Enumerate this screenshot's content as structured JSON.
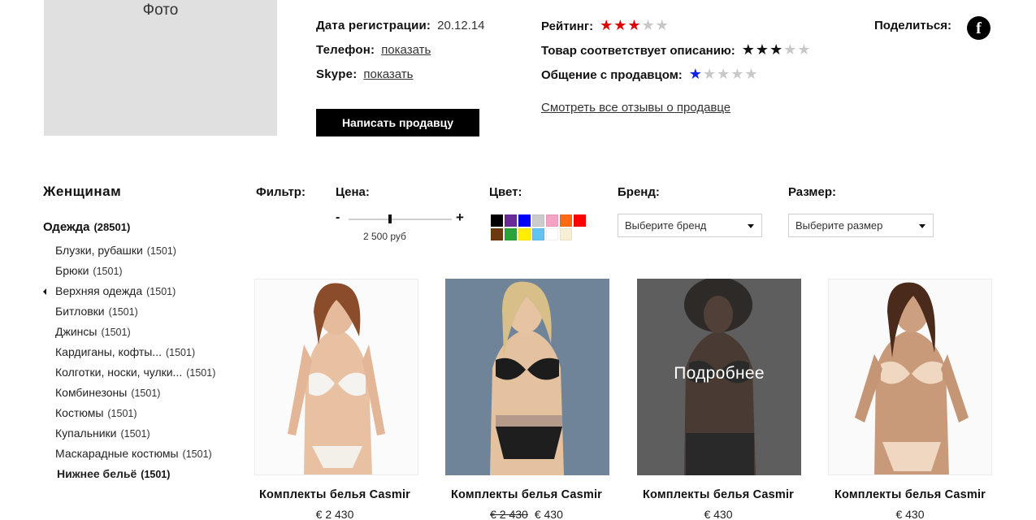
{
  "seller": {
    "photo_label": "Фото",
    "reg_label": "Дата регистрации:",
    "reg_date": "20.12.14",
    "phone_label": "Телефон:",
    "phone_link": "показать",
    "skype_label": "Skype:",
    "skype_link": "показать",
    "write_button": "Написать продавцу"
  },
  "ratings": {
    "rating_label": "Рейтинг:",
    "rating_value": 3,
    "description_label": "Товар соответствует описанию:",
    "description_value": 3,
    "communication_label": "Общение с продавцом:",
    "communication_value": 1,
    "max": 5,
    "colors": {
      "rating": "#e00000",
      "description": "#111111",
      "communication": "#1622e6",
      "off": "#c8c8c8"
    },
    "all_reviews_link": "Смотреть все отзывы о продавце"
  },
  "share": {
    "label": "Поделиться:",
    "icon": "facebook-icon",
    "icon_glyph": "f"
  },
  "sidebar": {
    "title": "Женщинам",
    "main_category": {
      "label": "Одежда",
      "count": "(28501)"
    },
    "items": [
      {
        "label": "Блузки, рубашки",
        "count": "(1501)"
      },
      {
        "label": "Брюки",
        "count": "(1501)"
      },
      {
        "label": "Верхняя одежда",
        "count": "(1501)"
      },
      {
        "label": "Битловки",
        "count": "(1501)"
      },
      {
        "label": "Джинсы",
        "count": "(1501)"
      },
      {
        "label": "Кардиганы, кофты...",
        "count": "(1501)"
      },
      {
        "label": "Колготки, носки, чулки...",
        "count": "(1501)"
      },
      {
        "label": "Комбинезоны",
        "count": "(1501)"
      },
      {
        "label": "Костюмы",
        "count": "(1501)"
      },
      {
        "label": "Купальники",
        "count": "(1501)"
      },
      {
        "label": "Маскарадные костюмы",
        "count": "(1501)"
      },
      {
        "label": "Нижнее бельё",
        "count": "(1501)"
      }
    ]
  },
  "filter": {
    "label": "Фильтр:",
    "price": {
      "label": "Цена:",
      "minus": "-",
      "plus": "+",
      "value": "2 500 руб",
      "level": 0.4
    },
    "color": {
      "label": "Цвет:",
      "swatches": [
        "#000000",
        "#6a2a9a",
        "#0000ff",
        "#cccccc",
        "#f4a3c4",
        "#ff6a13",
        "#ff0000",
        "#6b3a10",
        "#2aa33a",
        "#ffee00",
        "#62c4f0",
        "#ffffff",
        "#f7efd4"
      ]
    },
    "brand": {
      "label": "Бренд:",
      "placeholder": "Выберите бренд"
    },
    "size": {
      "label": "Размер:",
      "placeholder": "Выберите размер"
    }
  },
  "products": [
    {
      "title": "Комплекты белья Casmir",
      "old_price": "",
      "price": "€ 2 430"
    },
    {
      "title": "Комплекты белья Casmir",
      "old_price": "€ 2 430",
      "price": "€ 430"
    },
    {
      "title": "Комплекты белья Casmir",
      "old_price": "",
      "price": "€ 430",
      "overlay": "Подробнее"
    },
    {
      "title": "Комплекты белья Casmir",
      "old_price": "",
      "price": "€ 430"
    }
  ]
}
